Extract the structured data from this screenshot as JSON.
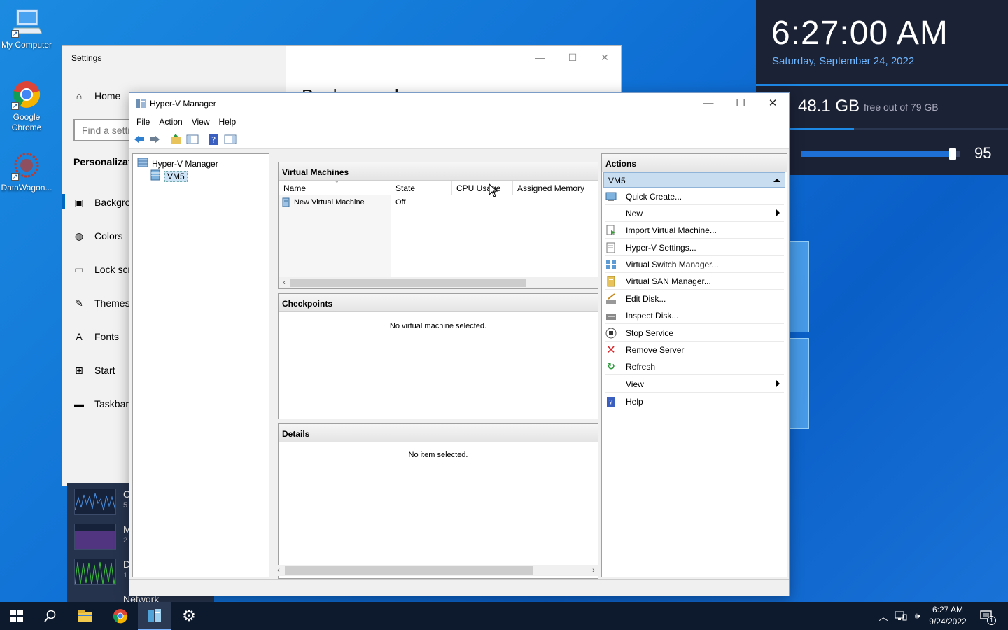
{
  "desktop": {
    "icons": [
      {
        "label": "My Computer"
      },
      {
        "label": "Google Chrome"
      },
      {
        "label": "DataWagon..."
      }
    ]
  },
  "widget": {
    "time": "6:27:00 AM",
    "date": "Saturday, September 24, 2022",
    "disk_free": "48.1 GB",
    "disk_total": "free out of 79 GB",
    "disk_used_fraction": 0.39,
    "volume": "95",
    "volume_level": 0.95
  },
  "settings": {
    "title": "Settings",
    "home": "Home",
    "search_placeholder": "Find a setting",
    "section": "Personalization",
    "heading": "Background",
    "items": [
      {
        "label": "Background",
        "icon": "picture-icon"
      },
      {
        "label": "Colors",
        "icon": "palette-icon"
      },
      {
        "label": "Lock screen",
        "icon": "lock-screen-icon"
      },
      {
        "label": "Themes",
        "icon": "brush-icon"
      },
      {
        "label": "Fonts",
        "icon": "font-icon"
      },
      {
        "label": "Start",
        "icon": "start-icon"
      },
      {
        "label": "Taskbar",
        "icon": "taskbar-icon"
      }
    ]
  },
  "resmon": {
    "rows": [
      {
        "label": "C",
        "sub": "5"
      },
      {
        "label": "M",
        "sub": "2"
      },
      {
        "label": "D",
        "sub": "1"
      },
      {
        "label": "Network",
        "sub": ""
      }
    ]
  },
  "hyperv": {
    "title": "Hyper-V Manager",
    "menu": [
      "File",
      "Action",
      "View",
      "Help"
    ],
    "tree": {
      "root": "Hyper-V Manager",
      "child": "VM5"
    },
    "vm_section": "Virtual Machines",
    "columns": [
      "Name",
      "State",
      "CPU Usage",
      "Assigned Memory"
    ],
    "rows": [
      {
        "name": "New Virtual Machine",
        "state": "Off",
        "cpu": "",
        "memory": ""
      }
    ],
    "checkpoints_section": "Checkpoints",
    "checkpoints_empty": "No virtual machine selected.",
    "details_section": "Details",
    "details_empty": "No item selected.",
    "actions_title": "Actions",
    "actions_group": "VM5",
    "actions": [
      {
        "label": "Quick Create...",
        "icon": "quick-create-icon",
        "submenu": false
      },
      {
        "label": "New",
        "icon": "",
        "submenu": true
      },
      {
        "label": "Import Virtual Machine...",
        "icon": "import-icon",
        "submenu": false
      },
      {
        "label": "Hyper-V Settings...",
        "icon": "settings-page-icon",
        "submenu": false
      },
      {
        "label": "Virtual Switch Manager...",
        "icon": "switch-icon",
        "submenu": false
      },
      {
        "label": "Virtual SAN Manager...",
        "icon": "san-icon",
        "submenu": false
      },
      {
        "label": "Edit Disk...",
        "icon": "edit-disk-icon",
        "submenu": false
      },
      {
        "label": "Inspect Disk...",
        "icon": "inspect-disk-icon",
        "submenu": false
      },
      {
        "label": "Stop Service",
        "icon": "stop-icon",
        "submenu": false
      },
      {
        "label": "Remove Server",
        "icon": "remove-icon",
        "submenu": false
      },
      {
        "label": "Refresh",
        "icon": "refresh-icon",
        "submenu": false
      },
      {
        "label": "View",
        "icon": "",
        "submenu": true
      },
      {
        "label": "Help",
        "icon": "help-icon",
        "submenu": false
      }
    ]
  },
  "taskbar": {
    "time": "6:27 AM",
    "date": "9/24/2022",
    "notification_count": "1"
  }
}
